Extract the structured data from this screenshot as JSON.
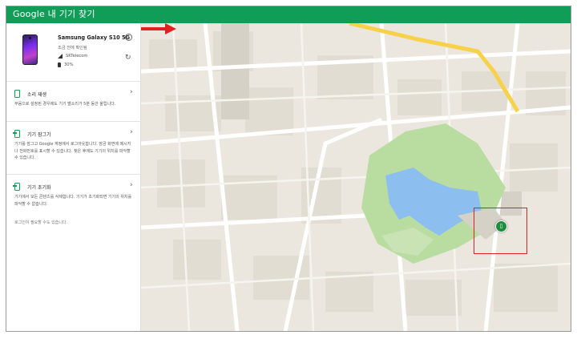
{
  "app": {
    "title": "Google 내 기기 찾기"
  },
  "device": {
    "name": "Samsung Galaxy S10 5G",
    "last_seen": "조금 전에 확인됨",
    "carrier": "SKTelecom",
    "battery": "30%"
  },
  "actions": [
    {
      "title": "소리 재생",
      "desc": "무음으로 설정된 경우에도 기기 벨소리가 5분 동안 울립니다."
    },
    {
      "title": "기기 잠그기",
      "desc": "기기를 잠그고 Google 계정에서 로그아웃합니다. 잠금 화면에 메시지나 전화번호를 표시할 수 있습니다. 찾은 후에도 기기의 위치를 파악할 수 있습니다."
    },
    {
      "title": "기기 초기화",
      "desc": "기기에서 모든 콘텐츠를 삭제합니다. 기기가 초기화되면 기기의 위치를 파악할 수 없습니다.",
      "note": "로그인이 필요할 수도 있습니다."
    }
  ],
  "colors": {
    "brand": "#0f9d58",
    "highlight": "#e02020",
    "marker": "#1e8e3e"
  },
  "icons": {
    "info": "info-icon",
    "refresh": "refresh-icon",
    "chevron": "chevron-right-icon"
  }
}
